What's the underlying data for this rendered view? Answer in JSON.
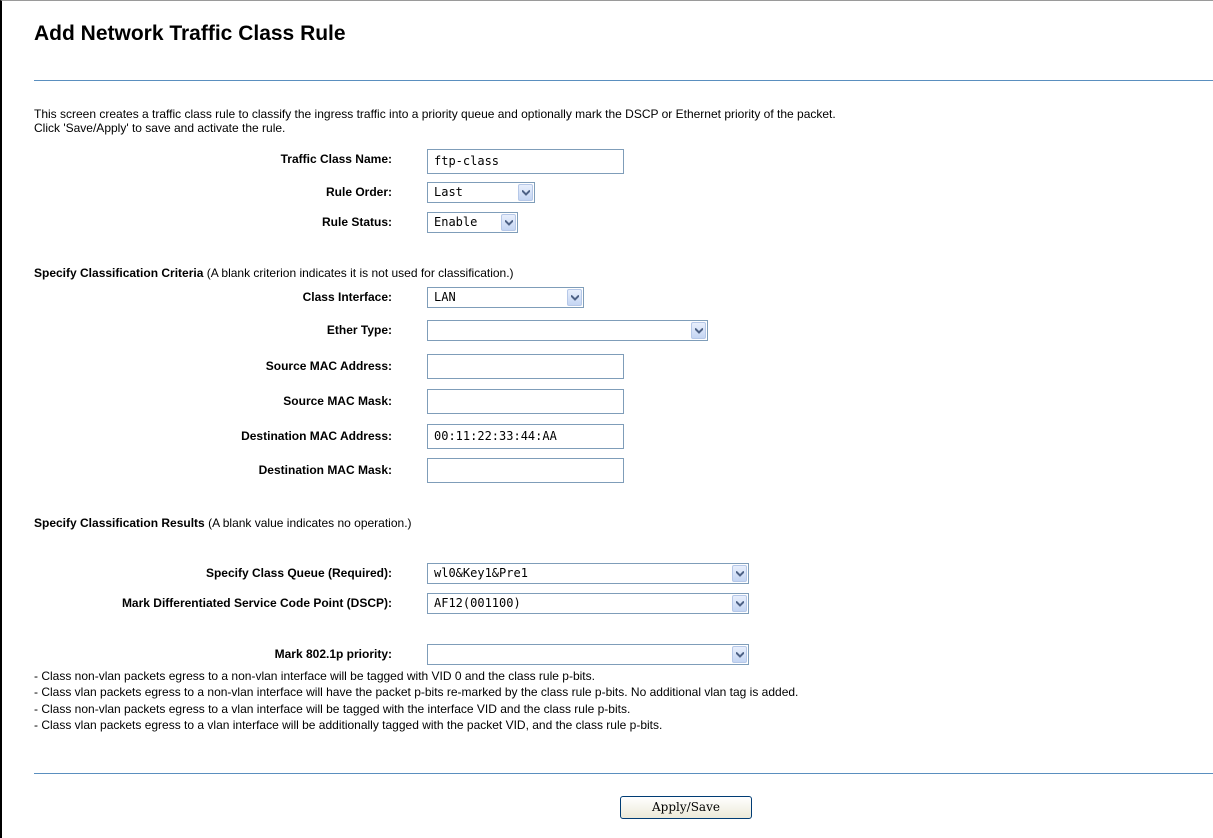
{
  "page": {
    "title": "Add Network Traffic Class Rule",
    "intro_line1": "This screen creates a traffic class rule to classify the ingress traffic into a priority queue and optionally mark the DSCP or Ethernet priority of the packet.",
    "intro_line2": "Click 'Save/Apply' to save and activate the rule."
  },
  "rule": {
    "name_label": "Traffic Class Name:",
    "name_value": "ftp-class",
    "order_label": "Rule Order:",
    "order_value": "Last",
    "status_label": "Rule Status:",
    "status_value": "Enable"
  },
  "criteria": {
    "heading_bold": "Specify Classification Criteria",
    "heading_note": " (A blank criterion indicates it is not used for classification.)",
    "class_interface_label": "Class Interface:",
    "class_interface_value": "LAN",
    "ether_type_label": "Ether Type:",
    "ether_type_value": "",
    "src_mac_label": "Source MAC Address:",
    "src_mac_value": "",
    "src_mask_label": "Source MAC Mask:",
    "src_mask_value": "",
    "dst_mac_label": "Destination MAC Address:",
    "dst_mac_value": "00:11:22:33:44:AA",
    "dst_mask_label": "Destination MAC Mask:",
    "dst_mask_value": ""
  },
  "results": {
    "heading_bold": "Specify Classification Results",
    "heading_note": " (A blank value indicates no operation.)",
    "queue_label": "Specify Class Queue (Required):",
    "queue_value": "wl0&Key1&Pre1",
    "dscp_label": "Mark Differentiated Service Code Point (DSCP):",
    "dscp_value": "AF12(001100)",
    "priority_label": "Mark 802.1p priority:",
    "priority_value": ""
  },
  "notes": [
    "- Class non-vlan packets egress to a non-vlan interface will be tagged with VID 0 and the class rule p-bits.",
    "- Class vlan packets egress to a non-vlan interface will have the packet p-bits re-marked by the class rule p-bits. No additional vlan tag is added.",
    "- Class non-vlan packets egress to a vlan interface will be tagged with the interface VID and the class rule p-bits.",
    "- Class vlan packets egress to a vlan interface will be additionally tagged with the packet VID, and the class rule p-bits."
  ],
  "apply_button": "Apply/Save",
  "colors": {
    "divider": "#5a8fbf",
    "field_border": "#7f9db9",
    "arrow_glyph": "#4d6185"
  }
}
